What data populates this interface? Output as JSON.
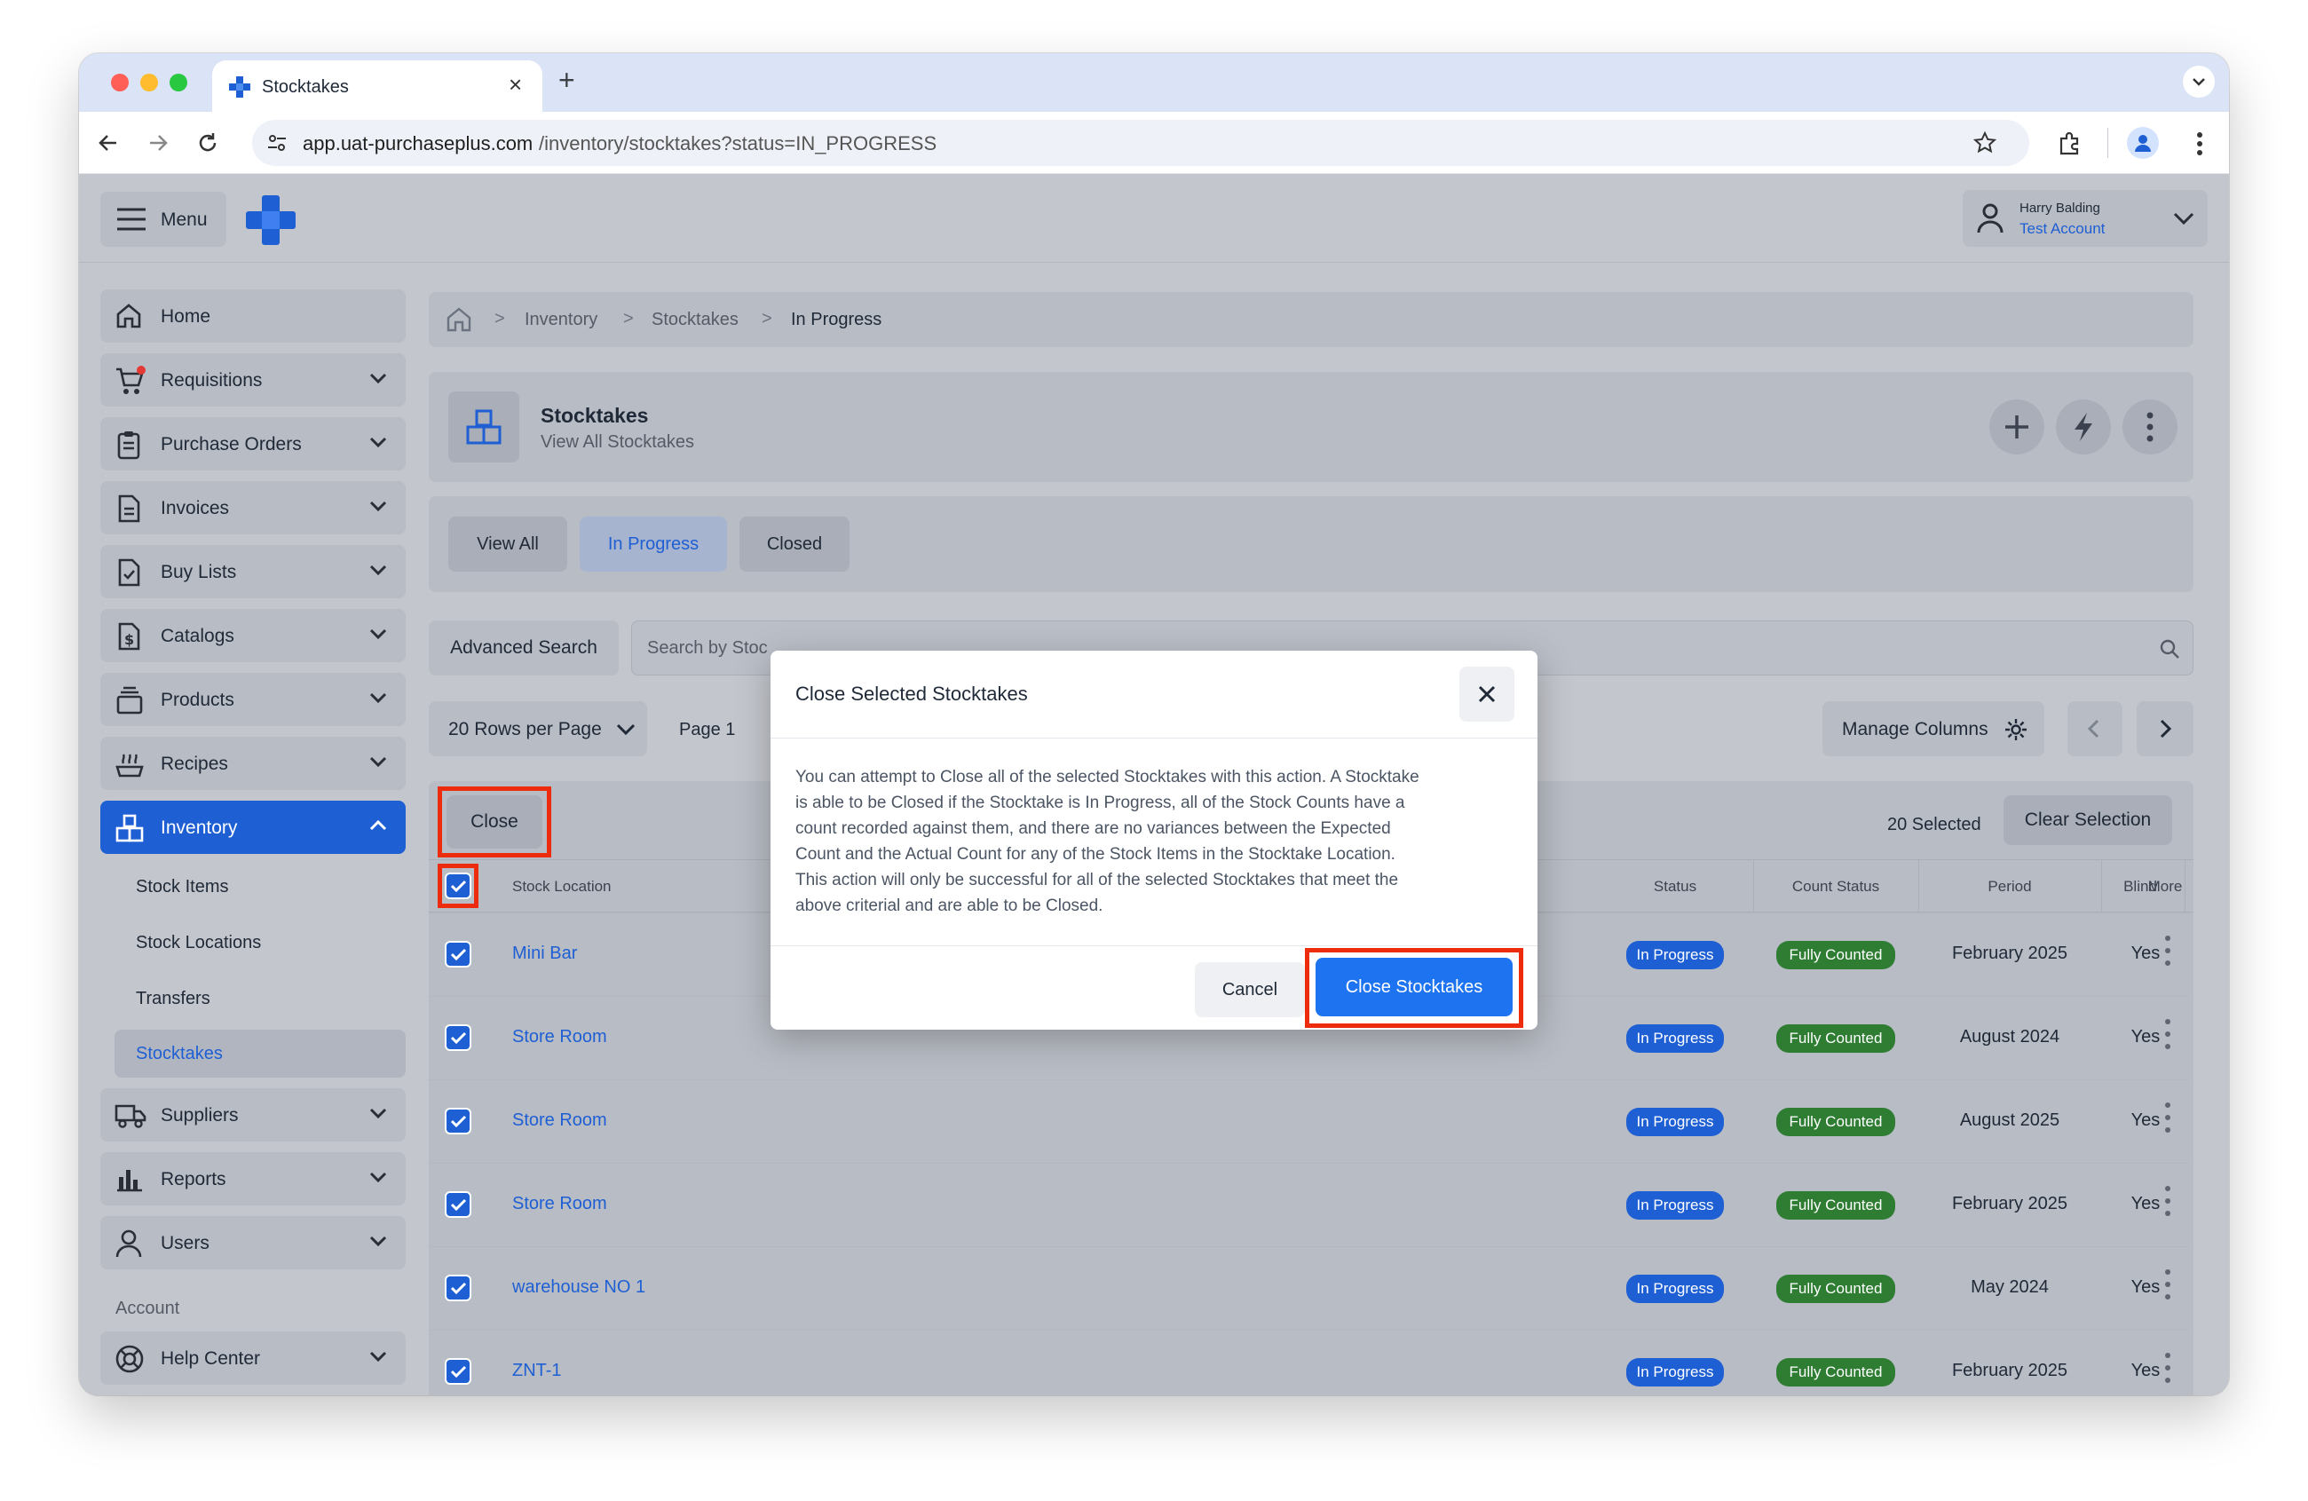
{
  "browser": {
    "tab_title": "Stocktakes",
    "url_domain": "app.uat-purchaseplus.com",
    "url_path": "/inventory/stocktakes?status=IN_PROGRESS"
  },
  "header": {
    "menu_label": "Menu",
    "user_name": "Harry Balding",
    "account_name": "Test Account"
  },
  "sidebar": {
    "items": [
      {
        "label": "Home"
      },
      {
        "label": "Requisitions"
      },
      {
        "label": "Purchase Orders"
      },
      {
        "label": "Invoices"
      },
      {
        "label": "Buy Lists"
      },
      {
        "label": "Catalogs"
      },
      {
        "label": "Products"
      },
      {
        "label": "Recipes"
      },
      {
        "label": "Inventory"
      },
      {
        "label": "Suppliers"
      },
      {
        "label": "Reports"
      },
      {
        "label": "Users"
      }
    ],
    "inventory_sub": [
      "Stock Items",
      "Stock Locations",
      "Transfers",
      "Stocktakes"
    ],
    "account_heading": "Account",
    "help_label": "Help Center"
  },
  "breadcrumb": {
    "items": [
      "Inventory",
      "Stocktakes",
      "In Progress"
    ]
  },
  "title_card": {
    "title": "Stocktakes",
    "subtitle": "View All Stocktakes"
  },
  "filter_tabs": [
    "View All",
    "In Progress",
    "Closed"
  ],
  "search": {
    "advanced_label": "Advanced Search",
    "placeholder": "Search by Stoc"
  },
  "pagination": {
    "rows_per_page": "20 Rows per Page",
    "page_label": "Page 1",
    "manage_columns": "Manage Columns"
  },
  "bulk": {
    "close_label": "Close",
    "selected_count": "20 Selected",
    "clear_label": "Clear Selection"
  },
  "table": {
    "headers": {
      "location": "Stock Location",
      "status": "Status",
      "count_status": "Count Status",
      "period": "Period",
      "blind": "Blind",
      "more": "More"
    },
    "rows": [
      {
        "location": "Mini Bar",
        "status": "In Progress",
        "count_status": "Fully Counted",
        "period": "February 2025",
        "blind": "Yes"
      },
      {
        "location": "Store Room",
        "status": "In Progress",
        "count_status": "Fully Counted",
        "period": "August 2024",
        "blind": "Yes"
      },
      {
        "location": "Store Room",
        "status": "In Progress",
        "count_status": "Fully Counted",
        "period": "August 2025",
        "blind": "Yes"
      },
      {
        "location": "Store Room",
        "status": "In Progress",
        "count_status": "Fully Counted",
        "period": "February 2025",
        "blind": "Yes"
      },
      {
        "location": "warehouse NO 1",
        "status": "In Progress",
        "count_status": "Fully Counted",
        "period": "May 2024",
        "blind": "Yes"
      },
      {
        "location": "ZNT-1",
        "status": "In Progress",
        "count_status": "Fully Counted",
        "period": "February 2025",
        "blind": "Yes"
      }
    ]
  },
  "modal": {
    "title": "Close Selected Stocktakes",
    "lines": [
      "You can attempt to Close all of the selected Stocktakes with this action. A Stocktake",
      "is able to be Closed if the Stocktake is In Progress, all of the Stock Counts have a",
      "count recorded against them, and there are no variances between the Expected",
      "Count and the Actual Count for any of the Stock Items in the Stocktake Location.",
      "This action will only be successful for all of the selected Stocktakes that meet the",
      "above criterial and are able to be Closed."
    ],
    "cancel_label": "Cancel",
    "confirm_label": "Close Stocktakes"
  },
  "colors": {
    "primary": "#1e5fd4",
    "success": "#2e7d32",
    "highlight": "#ec2c0c",
    "overlay_bg": "#c3c6cc"
  }
}
